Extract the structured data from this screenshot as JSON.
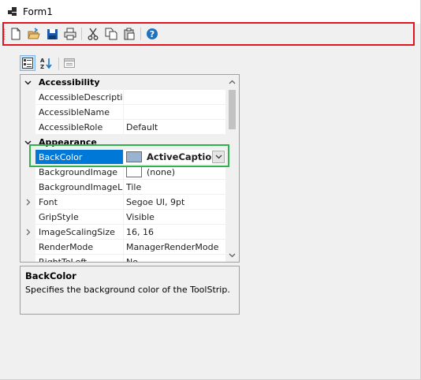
{
  "window": {
    "title": "Form1"
  },
  "toolbar": {
    "buttons": [
      {
        "name": "new-button",
        "icon": "new-document-icon"
      },
      {
        "name": "open-button",
        "icon": "open-folder-icon"
      },
      {
        "name": "save-button",
        "icon": "save-icon"
      },
      {
        "name": "print-button",
        "icon": "print-icon"
      },
      {
        "name": "cut-button",
        "icon": "cut-icon"
      },
      {
        "name": "copy-button",
        "icon": "copy-icon"
      },
      {
        "name": "paste-button",
        "icon": "paste-icon"
      },
      {
        "name": "help-button",
        "icon": "help-icon"
      }
    ]
  },
  "property_grid": {
    "toolbar": [
      {
        "name": "categorized-button",
        "icon": "categorized-icon",
        "active": true
      },
      {
        "name": "alphabetical-button",
        "icon": "sort-az-icon",
        "active": false
      },
      {
        "name": "property-pages-button",
        "icon": "property-pages-icon",
        "active": false
      }
    ],
    "rows": [
      {
        "type": "category",
        "label": "Accessibility",
        "expander": "collapse"
      },
      {
        "type": "property",
        "name": "AccessibleDescriptio",
        "value": ""
      },
      {
        "type": "property",
        "name": "AccessibleName",
        "value": ""
      },
      {
        "type": "property",
        "name": "AccessibleRole",
        "value": "Default"
      },
      {
        "type": "category",
        "label": "Appearance",
        "expander": "collapse"
      },
      {
        "type": "property",
        "name": "BackColor",
        "value": "ActiveCaption",
        "swatch": "#99b4d1",
        "selected": true,
        "bold": true
      },
      {
        "type": "property",
        "name": "BackgroundImage",
        "value": "(none)",
        "swatch": "#ffffff"
      },
      {
        "type": "property",
        "name": "BackgroundImageLa",
        "value": "Tile"
      },
      {
        "type": "property",
        "name": "Font",
        "value": "Segoe UI, 9pt",
        "expander": "expand"
      },
      {
        "type": "property",
        "name": "GripStyle",
        "value": "Visible"
      },
      {
        "type": "property",
        "name": "ImageScalingSize",
        "value": "16, 16",
        "expander": "expand"
      },
      {
        "type": "property",
        "name": "RenderMode",
        "value": "ManagerRenderMode"
      },
      {
        "type": "property",
        "name": "RightToLeft",
        "value": "No"
      }
    ]
  },
  "help": {
    "title": "BackColor",
    "description": "Specifies the background color of the ToolStrip."
  },
  "colors": {
    "highlight_red": "#e2141f",
    "highlight_green": "#2fb14b",
    "selection": "#0078d7",
    "active_caption": "#99b4d1"
  }
}
